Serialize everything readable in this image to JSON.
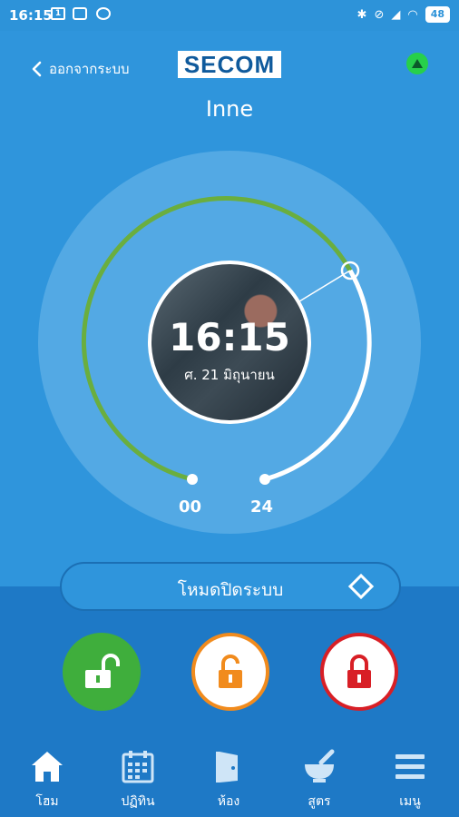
{
  "statusbar": {
    "time": "16:15",
    "notif_1": "1",
    "battery": "48"
  },
  "header": {
    "back_label": "ออกจากระบบ",
    "logo_text": "SECOM",
    "device_name": "Inne"
  },
  "dial": {
    "time": "16:15",
    "date": "ศ. 21 มิถุนายน",
    "start_label": "00",
    "end_label": "24",
    "colors": {
      "green_arc": "#6aae3f",
      "white_arc": "#ffffff"
    }
  },
  "mode": {
    "label": "โหมดปิดระบบ"
  },
  "lock_buttons": [
    {
      "name": "unlock-all",
      "color": "#3fae3c"
    },
    {
      "name": "partial-unlock",
      "color": "#f18b1d"
    },
    {
      "name": "lock-all",
      "color": "#d81f26"
    }
  ],
  "nav": {
    "items": [
      {
        "label": "โฮม",
        "icon": "home-icon"
      },
      {
        "label": "ปฏิทิน",
        "icon": "calendar-icon"
      },
      {
        "label": "ห้อง",
        "icon": "door-icon"
      },
      {
        "label": "สูตร",
        "icon": "mortar-icon"
      },
      {
        "label": "เมนู",
        "icon": "menu-icon"
      }
    ]
  }
}
